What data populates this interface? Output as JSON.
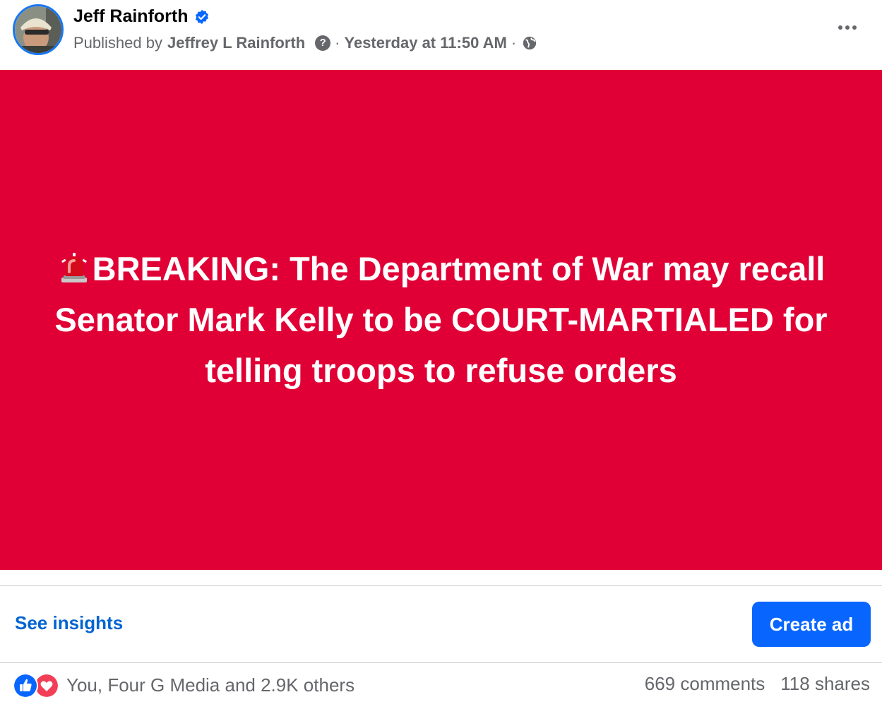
{
  "header": {
    "name": "Jeff Rainforth",
    "published_by_label": "Published by",
    "publisher": "Jeffrey L Rainforth",
    "separator": "·",
    "timestamp": "Yesterday at 11:50 AM"
  },
  "post": {
    "background_color": "#e00036",
    "text_color": "#ffffff",
    "text": "BREAKING: The Department of War may recall Senator Mark Kelly to be COURT-MARTIALED for telling troops to refuse orders"
  },
  "actions": {
    "see_insights": "See insights",
    "create_ad": "Create ad"
  },
  "footer": {
    "reactions_text": "You, Four G Media and 2.9K others",
    "comments": "669 comments",
    "shares": "118 shares"
  },
  "icons": {
    "verified": "verified-badge-icon",
    "help": "question-icon",
    "audience": "globe-icon",
    "siren": "siren-icon",
    "like": "like-icon",
    "love": "love-icon"
  },
  "colors": {
    "accent": "#0866ff",
    "link": "#0064d1",
    "secondary_text": "#65676b"
  }
}
